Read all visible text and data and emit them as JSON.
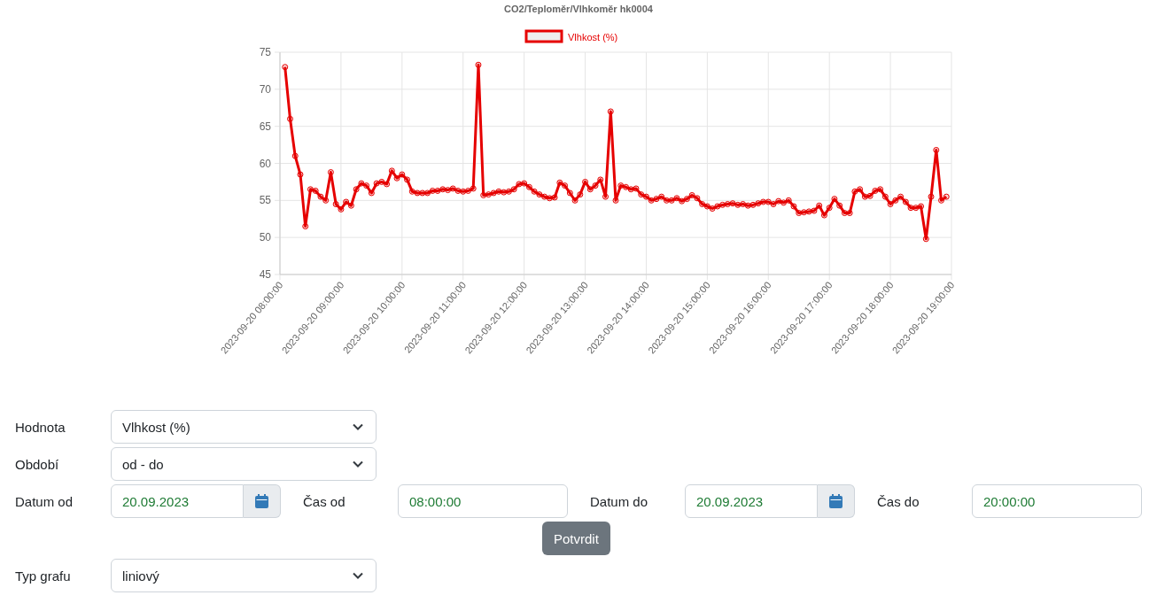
{
  "chart": {
    "chart_data": {
      "type": "line",
      "grid": true,
      "title": "CO2/Teploměr/Vlhkoměr hk0004",
      "categories": [
        "2023-09-20 08:00:00",
        null,
        null,
        null,
        null,
        null,
        null,
        null,
        null,
        null,
        null,
        null,
        "2023-09-20 09:00:00",
        null,
        null,
        null,
        null,
        null,
        null,
        null,
        null,
        null,
        null,
        null,
        "2023-09-20 10:00:00",
        null,
        null,
        null,
        null,
        null,
        null,
        null,
        null,
        null,
        null,
        null,
        "2023-09-20 11:00:00",
        null,
        null,
        null,
        null,
        null,
        null,
        null,
        null,
        null,
        null,
        null,
        "2023-09-20 12:00:00",
        null,
        null,
        null,
        null,
        null,
        null,
        null,
        null,
        null,
        null,
        null,
        "2023-09-20 13:00:00",
        null,
        null,
        null,
        null,
        null,
        null,
        null,
        null,
        null,
        null,
        null,
        "2023-09-20 14:00:00",
        null,
        null,
        null,
        null,
        null,
        null,
        null,
        null,
        null,
        null,
        null,
        "2023-09-20 15:00:00",
        null,
        null,
        null,
        null,
        null,
        null,
        null,
        null,
        null,
        null,
        null,
        "2023-09-20 16:00:00",
        null,
        null,
        null,
        null,
        null,
        null,
        null,
        null,
        null,
        null,
        null,
        "2023-09-20 17:00:00",
        null,
        null,
        null,
        null,
        null,
        null,
        null,
        null,
        null,
        null,
        null,
        "2023-09-20 18:00:00",
        null,
        null,
        null,
        null,
        null,
        null,
        null,
        null,
        null,
        null,
        null,
        "2023-09-20 19:00:00"
      ],
      "series": [
        {
          "name": "Vlhkost (%)",
          "color": "#e60000",
          "marker": "circle",
          "values": [
            null,
            73,
            66,
            61,
            58.5,
            51.5,
            56.5,
            56.3,
            55.5,
            55,
            58.8,
            54.5,
            53.8,
            54.8,
            54.3,
            56.5,
            57.3,
            57,
            56,
            57.3,
            57.5,
            57.2,
            59,
            58,
            58.5,
            57.8,
            56.2,
            56,
            56,
            56,
            56.3,
            56.3,
            56.5,
            56.4,
            56.6,
            56.3,
            56.2,
            56.3,
            56.6,
            73.3,
            55.7,
            55.8,
            56,
            56.2,
            56.1,
            56.2,
            56.5,
            57.2,
            57.3,
            56.8,
            56.2,
            55.8,
            55.5,
            55.3,
            55.4,
            57.4,
            57,
            56,
            55,
            55.8,
            57.5,
            56.5,
            57,
            57.8,
            55.5,
            67,
            55,
            57,
            56.8,
            56.5,
            56.6,
            55.8,
            55.5,
            55,
            55.2,
            55.5,
            55,
            55,
            55.3,
            54.9,
            55.2,
            55.7,
            55.3,
            54.5,
            54.2,
            53.9,
            54.2,
            54.4,
            54.5,
            54.6,
            54.4,
            54.5,
            54.3,
            54.4,
            54.6,
            54.8,
            54.8,
            54.5,
            54.9,
            54.7,
            55,
            54.2,
            53.3,
            53.4,
            53.5,
            53.6,
            54.3,
            53,
            54,
            55.2,
            54.3,
            53.3,
            53.3,
            56.2,
            56.5,
            55.5,
            55.6,
            56.3,
            56.5,
            55.5,
            54.5,
            55,
            55.5,
            54.8,
            54,
            54,
            54.2,
            49.8,
            55.5,
            61.8,
            55,
            55.5,
            null
          ]
        }
      ],
      "ylim": [
        45,
        75
      ],
      "yticks": [
        45,
        50,
        55,
        60,
        65,
        70,
        75
      ]
    }
  },
  "value_select": {
    "label": "Hodnota",
    "value": "Vlhkost (%)"
  },
  "period_select": {
    "label": "Období",
    "value": "od - do"
  },
  "range_fields": [
    {
      "kind": "date",
      "label": "Datum od",
      "value": "20.09.2023"
    },
    {
      "kind": "time",
      "label": "Čas od",
      "value": "08:00:00"
    },
    {
      "kind": "date",
      "label": "Datum do",
      "value": "20.09.2023"
    },
    {
      "kind": "time",
      "label": "Čas do",
      "value": "20:00:00"
    }
  ],
  "confirm_button": "Potvrdit",
  "chart_type_select": {
    "label": "Typ grafu",
    "value": "liniový"
  }
}
